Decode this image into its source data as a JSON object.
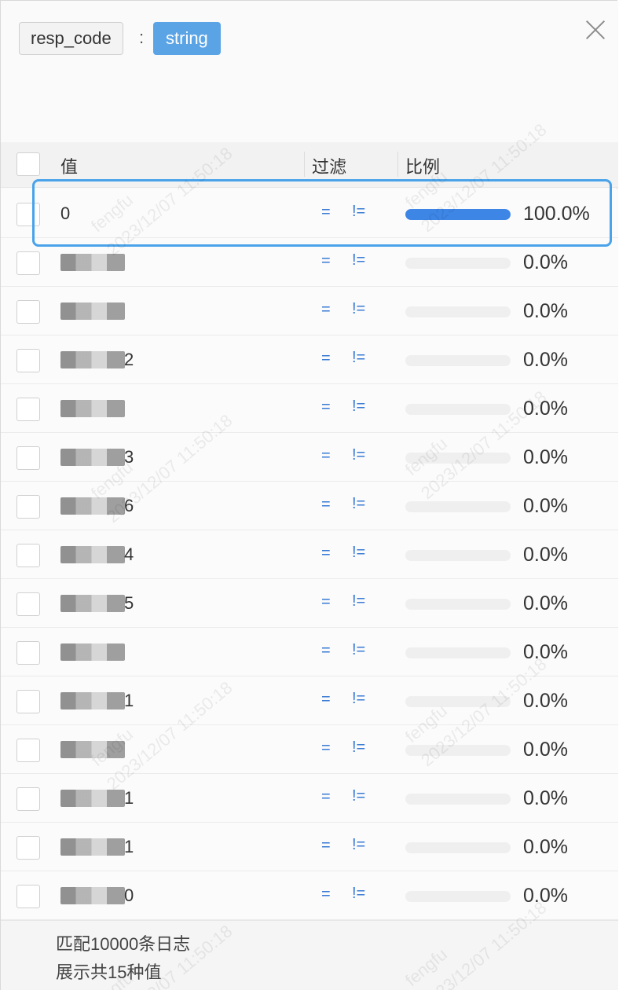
{
  "field": {
    "name": "resp_code",
    "separator": ":",
    "type": "string"
  },
  "table": {
    "headers": {
      "value": "值",
      "filter": "过滤",
      "ratio": "比例"
    },
    "rows": [
      {
        "value": "0",
        "eq": "=",
        "neq": "!=",
        "percent": "100.0%",
        "ratio": 1.0,
        "redacted": false
      },
      {
        "value": "",
        "eq": "=",
        "neq": "!=",
        "percent": "0.0%",
        "ratio": 0.0,
        "redacted": true
      },
      {
        "value": "",
        "eq": "=",
        "neq": "!=",
        "percent": "0.0%",
        "ratio": 0.0,
        "redacted": true
      },
      {
        "value": "2",
        "eq": "=",
        "neq": "!=",
        "percent": "0.0%",
        "ratio": 0.0,
        "redacted": true
      },
      {
        "value": "",
        "eq": "=",
        "neq": "!=",
        "percent": "0.0%",
        "ratio": 0.0,
        "redacted": true
      },
      {
        "value": "3",
        "eq": "=",
        "neq": "!=",
        "percent": "0.0%",
        "ratio": 0.0,
        "redacted": true
      },
      {
        "value": "6",
        "eq": "=",
        "neq": "!=",
        "percent": "0.0%",
        "ratio": 0.0,
        "redacted": true
      },
      {
        "value": "4",
        "eq": "=",
        "neq": "!=",
        "percent": "0.0%",
        "ratio": 0.0,
        "redacted": true
      },
      {
        "value": "5",
        "eq": "=",
        "neq": "!=",
        "percent": "0.0%",
        "ratio": 0.0,
        "redacted": true
      },
      {
        "value": "",
        "eq": "=",
        "neq": "!=",
        "percent": "0.0%",
        "ratio": 0.0,
        "redacted": true
      },
      {
        "value": "1",
        "eq": "=",
        "neq": "!=",
        "percent": "0.0%",
        "ratio": 0.0,
        "redacted": true
      },
      {
        "value": "",
        "eq": "=",
        "neq": "!=",
        "percent": "0.0%",
        "ratio": 0.0,
        "redacted": true
      },
      {
        "value": "1",
        "eq": "=",
        "neq": "!=",
        "percent": "0.0%",
        "ratio": 0.0,
        "redacted": true
      },
      {
        "value": "1",
        "eq": "=",
        "neq": "!=",
        "percent": "0.0%",
        "ratio": 0.0,
        "redacted": true
      },
      {
        "value": "0",
        "eq": "=",
        "neq": "!=",
        "percent": "0.0%",
        "ratio": 0.0,
        "redacted": true
      }
    ]
  },
  "footer": {
    "matched": "匹配10000条日志",
    "distinct": "展示共15种值"
  },
  "watermark": {
    "user": "fengfu",
    "time": "2023/12/07 11:50:18"
  },
  "colors": {
    "accent": "#3d86e6",
    "type_tag": "#5aa4e6",
    "highlight": "#4aa3ea",
    "link": "#3a7bd5"
  }
}
